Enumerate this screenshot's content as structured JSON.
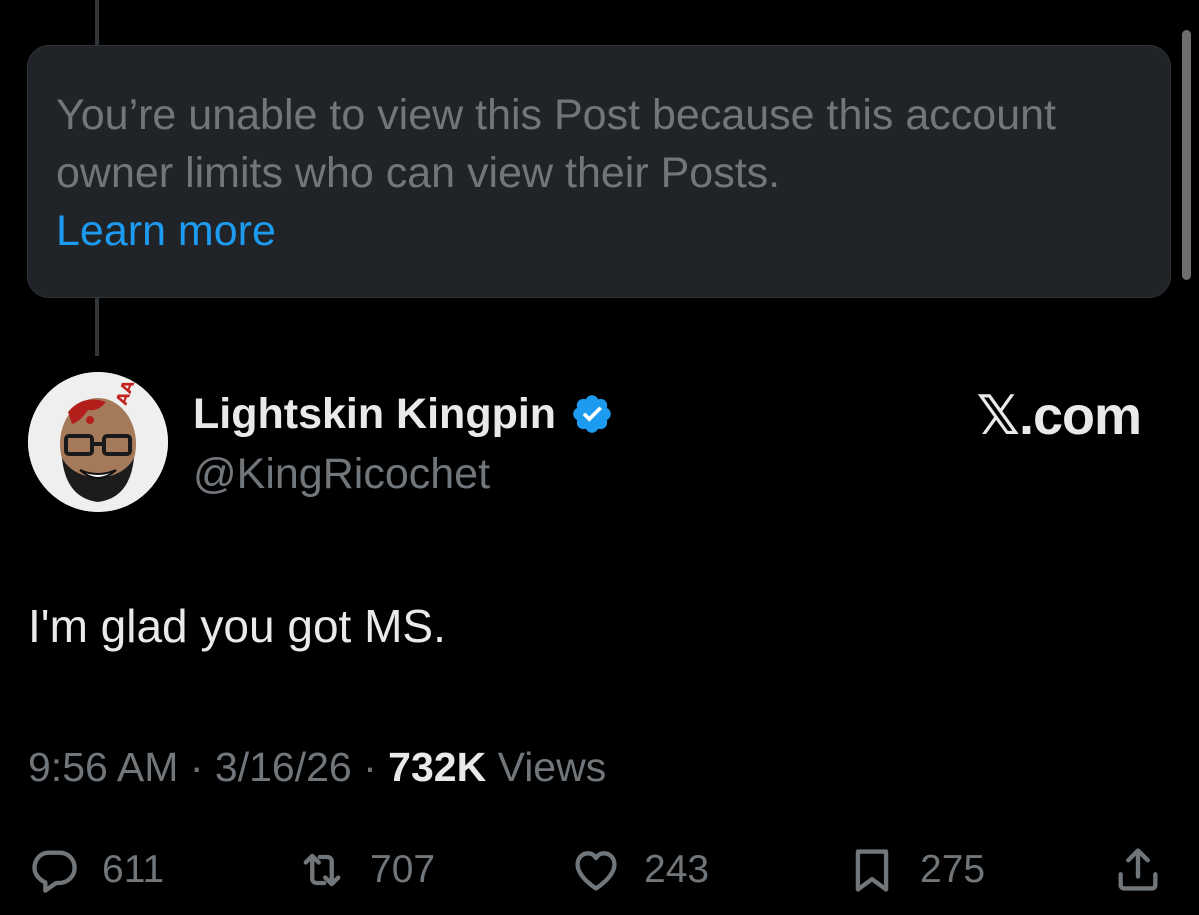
{
  "notice": {
    "message": "You’re unable to view this Post because this account owner limits who can view their Posts.",
    "link": "Learn more"
  },
  "author": {
    "name": "Lightskin Kingpin",
    "handle": "@KingRicochet",
    "verified": true,
    "avatar_icon": "avatar-illustration"
  },
  "site_logo": "𝕏.com",
  "post": {
    "text": "I'm glad you got MS."
  },
  "meta": {
    "time": "9:56 AM",
    "separator": "·",
    "date": "3/16/26",
    "views_count": "732K",
    "views_label": "Views"
  },
  "actions": {
    "reply_count": "611",
    "repost_count": "707",
    "like_count": "243",
    "bookmark_count": "275"
  },
  "colors": {
    "background": "#000000",
    "accent": "#1d9bf0",
    "muted": "#71767b",
    "text": "#e7e9ea",
    "notice_bg": "#202327"
  }
}
